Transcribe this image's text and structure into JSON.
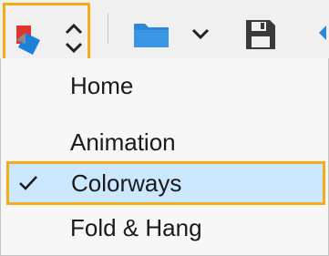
{
  "toolbar": {
    "mode_icon": "layers-color-icon",
    "mode_toggle_icon": "chevron-up-down-icon",
    "open_icon": "folder-icon",
    "open_dropdown_icon": "chevron-down-icon",
    "save_icon": "floppy-disk-icon",
    "accent": "#2b88d8",
    "highlight": "#f3ab16"
  },
  "menu": {
    "items": [
      {
        "label": "Home",
        "checked": false
      },
      {
        "label": "Animation",
        "checked": false
      },
      {
        "label": "Colorways",
        "checked": true
      },
      {
        "label": "Fold & Hang",
        "checked": false
      }
    ],
    "selected_bg": "#cce8ff"
  }
}
